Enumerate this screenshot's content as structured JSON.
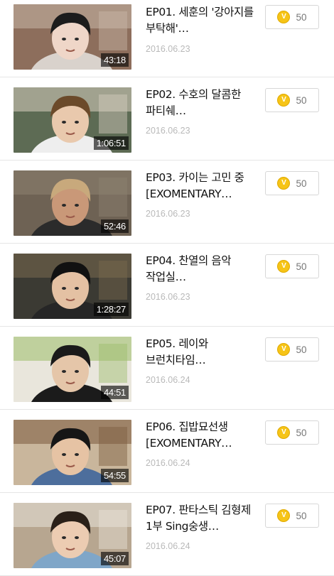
{
  "coin_symbol": "V",
  "colors": {
    "coin": "#f6c417",
    "divider": "#e6e6e6",
    "date": "#b9b9b9"
  },
  "episodes": [
    {
      "title": "EP01. 세훈의 '강아지를 부탁해'…",
      "date": "2016.06.23",
      "duration": "43:18",
      "price": "50",
      "thumb": {
        "bg": "#8d6e5c",
        "accent": "#c9b8a8",
        "skin": "#efd6c8",
        "hair": "#1c1c1c",
        "cloth": "#d9d2cc"
      }
    },
    {
      "title": "EP02. 수호의 달콤한 파티쉐…",
      "date": "2016.06.23",
      "duration": "1:06:51",
      "price": "50",
      "thumb": {
        "bg": "#5d6b54",
        "accent": "#d8cfc0",
        "skin": "#e9c9ad",
        "hair": "#6b4a2a",
        "cloth": "#eeeeee"
      }
    },
    {
      "title": "EP03. 카이는 고민 중 [EXOMENTARY…",
      "date": "2016.06.23",
      "duration": "52:46",
      "price": "50",
      "thumb": {
        "bg": "#6e6254",
        "accent": "#8e8270",
        "skin": "#c99878",
        "hair": "#c8a97c",
        "cloth": "#2b2b2b"
      }
    },
    {
      "title": "EP04. 찬열의 음악 작업실…",
      "date": "2016.06.23",
      "duration": "1:28:27",
      "price": "50",
      "thumb": {
        "bg": "#3b3a33",
        "accent": "#7a6a4e",
        "skin": "#e4c1a3",
        "hair": "#111111",
        "cloth": "#262626"
      }
    },
    {
      "title": "EP05. 레이와 브런치타임…",
      "date": "2016.06.24",
      "duration": "44:51",
      "price": "50",
      "thumb": {
        "bg": "#e9e6dc",
        "accent": "#9cbd6a",
        "skin": "#e5c6a9",
        "hair": "#1a1a1a",
        "cloth": "#1b1b1b"
      }
    },
    {
      "title": "EP06. 집밥묘선생 [EXOMENTARY…",
      "date": "2016.06.24",
      "duration": "54:55",
      "price": "50",
      "thumb": {
        "bg": "#c9b69c",
        "accent": "#7a5a3e",
        "skin": "#e6c3a4",
        "hair": "#161616",
        "cloth": "#4d6e9c"
      }
    },
    {
      "title": "EP07. 판타스틱 김형제 1부 Sing숭생…",
      "date": "2016.06.24",
      "duration": "45:07",
      "price": "50",
      "thumb": {
        "bg": "#b7a690",
        "accent": "#e8e2d8",
        "skin": "#ecccb2",
        "hair": "#2a2018",
        "cloth": "#7fa6c8"
      }
    }
  ]
}
